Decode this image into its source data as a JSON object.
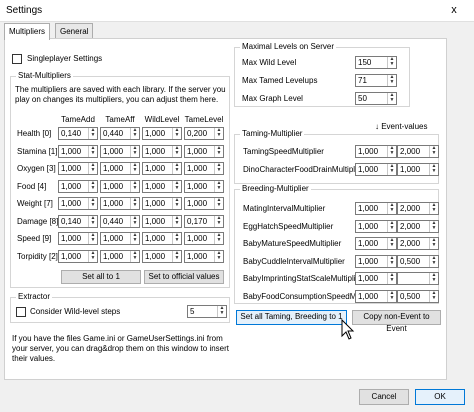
{
  "window": {
    "title": "Settings",
    "close": "x"
  },
  "tabs": [
    "Multipliers",
    "General"
  ],
  "singleplayer": {
    "label": "Singleplayer Settings"
  },
  "stat": {
    "title": "Stat-Multipliers",
    "desc": "The multipliers are saved with each library. If the server you play on changes its multipliers, you can adjust them here.",
    "headers": [
      "TameAdd",
      "TameAff",
      "WildLevel",
      "TameLevel"
    ],
    "rows": [
      {
        "label": "Health [0]",
        "values": [
          "0,140",
          "0,440",
          "1,000",
          "0,200"
        ]
      },
      {
        "label": "Stamina [1]",
        "values": [
          "1,000",
          "1,000",
          "1,000",
          "1,000"
        ]
      },
      {
        "label": "Oxygen [3]",
        "values": [
          "1,000",
          "1,000",
          "1,000",
          "1,000"
        ]
      },
      {
        "label": "Food [4]",
        "values": [
          "1,000",
          "1,000",
          "1,000",
          "1,000"
        ]
      },
      {
        "label": "Weight [7]",
        "values": [
          "1,000",
          "1,000",
          "1,000",
          "1,000"
        ]
      },
      {
        "label": "Damage [8]",
        "values": [
          "0,140",
          "0,440",
          "1,000",
          "0,170"
        ]
      },
      {
        "label": "Speed [9]",
        "values": [
          "1,000",
          "1,000",
          "1,000",
          "1,000"
        ]
      },
      {
        "label": "Torpidity [2]",
        "values": [
          "1,000",
          "1,000",
          "1,000",
          "1,000"
        ]
      }
    ],
    "set_all": "Set all to 1",
    "set_official": "Set to official values"
  },
  "extractor": {
    "title": "Extractor",
    "wild_label": "Consider Wild-level steps",
    "wild_value": "5"
  },
  "hint": "If you have the files Game.ini or GameUserSettings.ini from your server, you can drag&drop them on this window to insert their values.",
  "maxlevels": {
    "title": "Maximal Levels on Server",
    "rows": [
      {
        "label": "Max Wild Level",
        "value": "150"
      },
      {
        "label": "Max Tamed Levelups",
        "value": "71"
      },
      {
        "label": "Max Graph Level",
        "value": "50"
      }
    ]
  },
  "event_values": "↓ Event-values",
  "taming": {
    "title": "Taming-Multiplier",
    "rows": [
      {
        "label": "TamingSpeedMultiplier",
        "value": "1,000",
        "event": "2,000"
      },
      {
        "label": "DinoCharacterFoodDrainMultiplier",
        "value": "1,000",
        "event": "1,000"
      }
    ]
  },
  "breeding": {
    "title": "Breeding-Multiplier",
    "rows": [
      {
        "label": "MatingIntervalMultiplier",
        "value": "1,000",
        "event": "2,000"
      },
      {
        "label": "EggHatchSpeedMultiplier",
        "value": "1,000",
        "event": "2,000"
      },
      {
        "label": "BabyMatureSpeedMultiplier",
        "value": "1,000",
        "event": "2,000"
      },
      {
        "label": "BabyCuddleIntervalMultiplier",
        "value": "1,000",
        "event": "0,500"
      },
      {
        "label": "BabyImprintingStatScaleMultiplier",
        "value": "1,000",
        "event": ""
      },
      {
        "label": "BabyFoodConsumptionSpeedMult",
        "value": "1,000",
        "event": "0,500"
      }
    ]
  },
  "buttons": {
    "set_taming": "Set all Taming, Breeding to 1",
    "copy_event": "Copy non-Event to Event",
    "cancel": "Cancel",
    "ok": "OK"
  }
}
